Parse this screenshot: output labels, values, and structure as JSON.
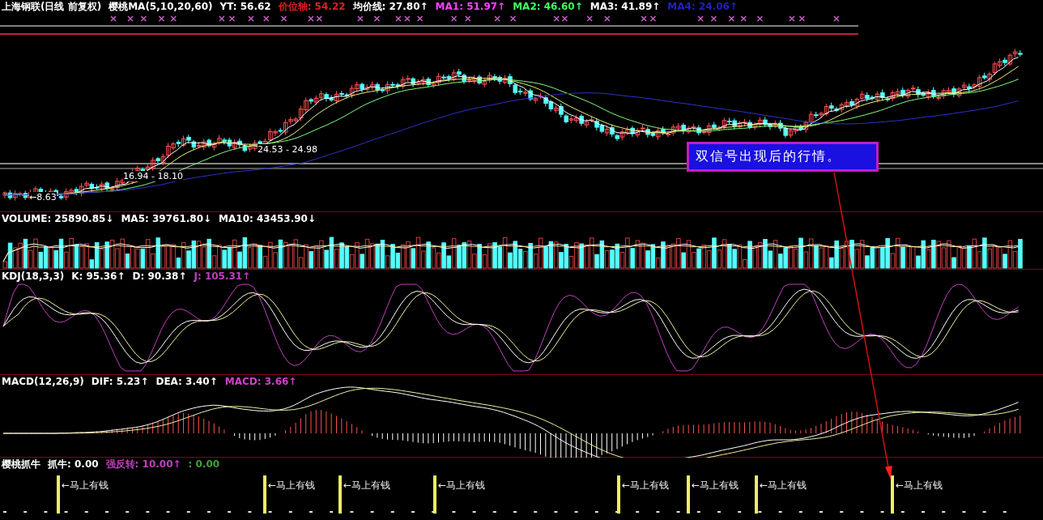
{
  "main_panel": {
    "indicators": [
      {
        "text": "上海钢联(日线 前复权)",
        "color": "#ffffff"
      },
      {
        "text": "樱桃MA(5,10,20,60)",
        "color": "#ffffff"
      },
      {
        "text": "YT: 56.62",
        "color": "#ffffff"
      },
      {
        "text": "价位轴: 54.22",
        "color": "#e02020"
      },
      {
        "text": "均价线: 27.80↑",
        "color": "#ffffff"
      },
      {
        "text": "MA1: 51.97↑",
        "color": "#ff40ff"
      },
      {
        "text": "MA2: 46.60↑",
        "color": "#40ff60"
      },
      {
        "text": "MA3: 41.89↑",
        "color": "#ffffff"
      },
      {
        "text": "MA4: 24.06↑",
        "color": "#2020c0"
      }
    ],
    "price_labels": [
      "24.53 - 24.98",
      "16.94 - 18.10",
      "←8.63"
    ],
    "callout": "双信号出现后的行情。"
  },
  "volume_panel": {
    "indicators": [
      {
        "text": "VOLUME: 25890.85↓",
        "color": "#ffffff"
      },
      {
        "text": "MA5: 39761.80↓",
        "color": "#ffffff"
      },
      {
        "text": "MA10: 43453.90↓",
        "color": "#ffffff"
      }
    ]
  },
  "kdj_panel": {
    "indicators": [
      {
        "text": "KDJ(18,3,3)",
        "color": "#ffffff"
      },
      {
        "text": "K: 95.36↑",
        "color": "#ffffff"
      },
      {
        "text": "D: 90.38↑",
        "color": "#ffffff"
      },
      {
        "text": "J: 105.31↑",
        "color": "#c040c0"
      }
    ]
  },
  "macd_panel": {
    "indicators": [
      {
        "text": "MACD(12,26,9)",
        "color": "#ffffff"
      },
      {
        "text": "DIF: 5.23↑",
        "color": "#ffffff"
      },
      {
        "text": "DEA: 3.40↑",
        "color": "#ffffff"
      },
      {
        "text": "MACD: 3.66↑",
        "color": "#d040d0"
      }
    ]
  },
  "signal_panel": {
    "indicators": [
      {
        "text": "樱桃抓牛",
        "color": "#ffffff"
      },
      {
        "text": "抓牛: 0.00",
        "color": "#ffffff"
      },
      {
        "text": "强反转: 10.00↑",
        "color": "#c040c0"
      },
      {
        "text": ": 0.00",
        "color": "#40a040"
      }
    ],
    "signals": [
      {
        "label": "←马上有钱"
      },
      {
        "label": "←马上有钱"
      },
      {
        "label": "←马上有钱"
      },
      {
        "label": "←马上有钱"
      },
      {
        "label": "←马上有钱"
      },
      {
        "label": "←马上有钱"
      },
      {
        "label": "←马上有钱"
      },
      {
        "label": "←马上有钱"
      }
    ]
  }
}
